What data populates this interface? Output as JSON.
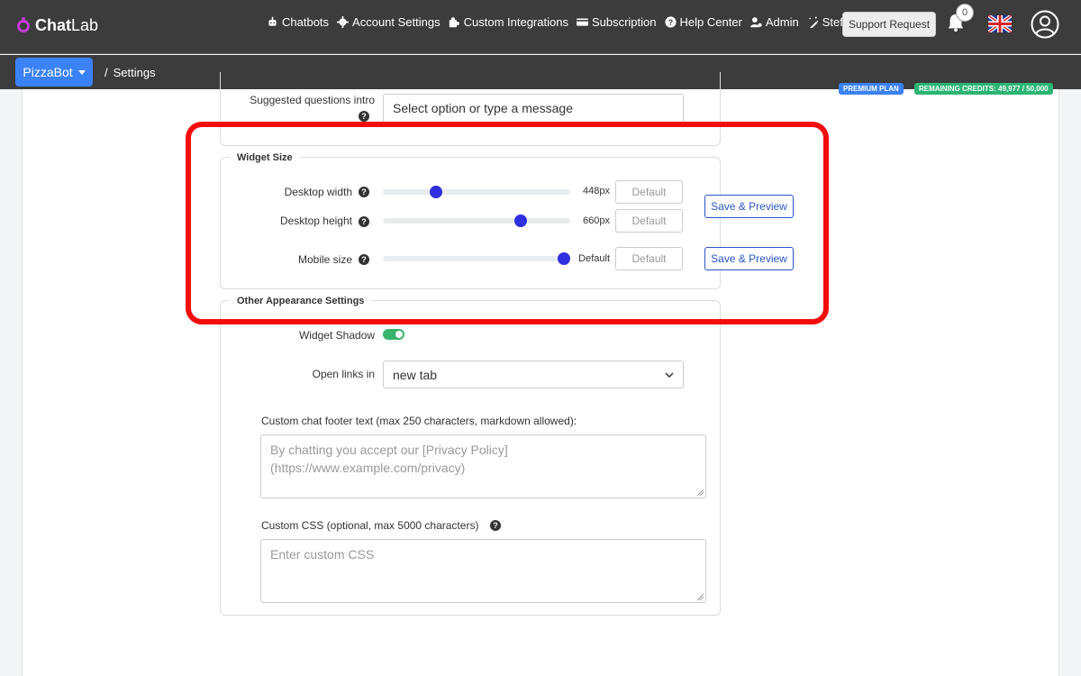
{
  "brand": {
    "name_bold": "Chat",
    "name_light": "Lab"
  },
  "nav": [
    {
      "label": "Chatbots",
      "icon": "robot-icon"
    },
    {
      "label": "Account Settings",
      "icon": "gear-icon"
    },
    {
      "label": "Custom Integrations",
      "icon": "puzzle-icon"
    },
    {
      "label": "Subscription",
      "icon": "credit-card-icon"
    },
    {
      "label": "Help Center",
      "icon": "question-circle-icon"
    },
    {
      "label": "Admin",
      "icon": "user-gear-icon"
    },
    {
      "label": "Stefan AI",
      "icon": "magic-wand-icon"
    }
  ],
  "header": {
    "support_label": "Support Request",
    "notification_count": "0",
    "language_icon": "uk-flag-icon"
  },
  "subbar": {
    "bot_name": "PizzaBot",
    "breadcrumb_sep": "/",
    "breadcrumb_page": "Settings",
    "plan_badge": "PREMIUM PLAN",
    "credits_badge": "REMAINING CREDITS: 49,977 / 50,000"
  },
  "suggested": {
    "label": "Suggested questions intro",
    "value": "Select option or type a message"
  },
  "widget_size": {
    "legend": "Widget Size",
    "rows": [
      {
        "label": "Desktop width",
        "value_text": "448px",
        "slider_fraction": 0.27,
        "default_placeholder": "Default"
      },
      {
        "label": "Desktop height",
        "value_text": "660px",
        "slider_fraction": 0.75,
        "default_placeholder": "Default"
      },
      {
        "label": "Mobile size",
        "value_text": "Default",
        "slider_fraction": 1.0,
        "default_placeholder": "Default"
      }
    ],
    "save_label": "Save & Preview"
  },
  "other": {
    "legend": "Other Appearance Settings",
    "shadow_label": "Widget Shadow",
    "shadow_on": true,
    "open_links_label": "Open links in",
    "open_links_value": "new tab",
    "footer_label": "Custom chat footer text (max 250 characters, markdown allowed):",
    "footer_placeholder": "By chatting you accept our [Privacy Policy](https://www.example.com/privacy)",
    "css_label": "Custom CSS (optional, max 5000 characters)",
    "css_placeholder": "Enter custom CSS"
  },
  "colors": {
    "accent": "#3b82f6",
    "highlight": "#f20d0d",
    "slider_thumb": "#2f2fe0",
    "toggle_on": "#38b36b",
    "credits": "#2bb573"
  }
}
